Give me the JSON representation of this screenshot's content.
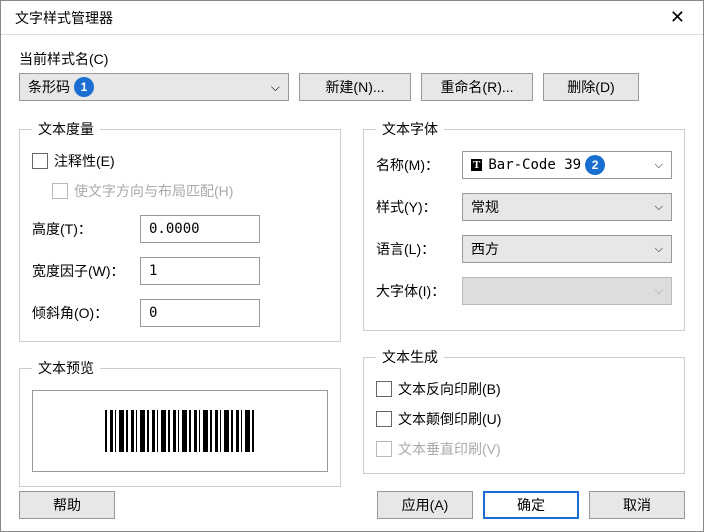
{
  "title": "文字样式管理器",
  "top": {
    "current_style_label": "当前样式名(C)",
    "current_style_value": "条形码",
    "badge1": "1",
    "new_btn": "新建(N)...",
    "rename_btn": "重命名(R)...",
    "delete_btn": "删除(D)"
  },
  "metrics": {
    "legend": "文本度量",
    "annotative": "注释性(E)",
    "match_orient": "使文字方向与布局匹配(H)",
    "height_label": "高度(T)：",
    "height_value": "0.0000",
    "width_label": "宽度因子(W)：",
    "width_value": "1",
    "oblique_label": "倾斜角(O)：",
    "oblique_value": "0"
  },
  "font": {
    "legend": "文本字体",
    "name_label": "名称(M)：",
    "name_value": "Bar-Code 39",
    "badge2": "2",
    "style_label": "样式(Y)：",
    "style_value": "常规",
    "lang_label": "语言(L)：",
    "lang_value": "西方",
    "bigfont_label": "大字体(I)："
  },
  "preview": {
    "legend": "文本预览"
  },
  "gen": {
    "legend": "文本生成",
    "backwards": "文本反向印刷(B)",
    "upside": "文本颠倒印刷(U)",
    "vertical": "文本垂直印刷(V)"
  },
  "buttons": {
    "help": "帮助",
    "apply": "应用(A)",
    "ok": "确定",
    "cancel": "取消"
  }
}
